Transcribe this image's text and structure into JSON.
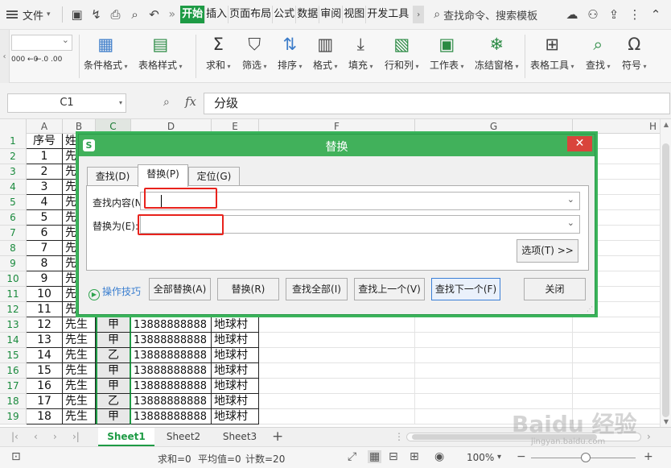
{
  "menubar": {
    "file": "文件",
    "tabs": [
      "开始",
      "插入",
      "页面布局",
      "公式",
      "数据",
      "审阅",
      "视图",
      "开发工具"
    ],
    "active_tab": "开始",
    "search_placeholder": "查找命令、搜索模板"
  },
  "ribbon": {
    "number_formats": [
      "000 ←0",
      "←.0 .00"
    ],
    "items": [
      {
        "label": "条件格式",
        "icon": "conditional-format-icon"
      },
      {
        "label": "表格样式",
        "icon": "table-style-icon"
      },
      {
        "label": "求和",
        "icon": "sum-icon"
      },
      {
        "label": "筛选",
        "icon": "filter-icon"
      },
      {
        "label": "排序",
        "icon": "sort-icon"
      },
      {
        "label": "格式",
        "icon": "format-icon"
      },
      {
        "label": "填充",
        "icon": "fill-icon"
      },
      {
        "label": "行和列",
        "icon": "row-col-icon"
      },
      {
        "label": "工作表",
        "icon": "worksheet-icon"
      },
      {
        "label": "冻结窗格",
        "icon": "freeze-icon"
      },
      {
        "label": "表格工具",
        "icon": "table-tool-icon"
      },
      {
        "label": "查找",
        "icon": "find-icon"
      },
      {
        "label": "符号",
        "icon": "symbol-icon"
      }
    ]
  },
  "formula_bar": {
    "name_box": "C1",
    "fx": "fx",
    "content": "分级"
  },
  "grid": {
    "columns": [
      "A",
      "B",
      "C",
      "D",
      "E",
      "F",
      "G",
      "H"
    ],
    "selected_column": "C",
    "rows": [
      {
        "n": "1",
        "a": "序号",
        "b": "姓",
        "c": "",
        "d": "",
        "e": ""
      },
      {
        "n": "2",
        "a": "1",
        "b": "先",
        "c": "",
        "d": "",
        "e": ""
      },
      {
        "n": "3",
        "a": "2",
        "b": "先",
        "c": "",
        "d": "",
        "e": ""
      },
      {
        "n": "4",
        "a": "3",
        "b": "先",
        "c": "",
        "d": "",
        "e": ""
      },
      {
        "n": "5",
        "a": "4",
        "b": "先",
        "c": "",
        "d": "",
        "e": ""
      },
      {
        "n": "6",
        "a": "5",
        "b": "先",
        "c": "",
        "d": "",
        "e": ""
      },
      {
        "n": "7",
        "a": "6",
        "b": "先",
        "c": "",
        "d": "",
        "e": ""
      },
      {
        "n": "8",
        "a": "7",
        "b": "先",
        "c": "",
        "d": "",
        "e": ""
      },
      {
        "n": "9",
        "a": "8",
        "b": "先",
        "c": "",
        "d": "",
        "e": ""
      },
      {
        "n": "10",
        "a": "9",
        "b": "先",
        "c": "",
        "d": "",
        "e": ""
      },
      {
        "n": "11",
        "a": "10",
        "b": "先",
        "c": "",
        "d": "",
        "e": ""
      },
      {
        "n": "12",
        "a": "11",
        "b": "先",
        "c": "",
        "d": "",
        "e": ""
      },
      {
        "n": "13",
        "a": "12",
        "b": "先生",
        "c": "甲",
        "d": "13888888888",
        "e": "地球村"
      },
      {
        "n": "14",
        "a": "13",
        "b": "先生",
        "c": "甲",
        "d": "13888888888",
        "e": "地球村"
      },
      {
        "n": "15",
        "a": "14",
        "b": "先生",
        "c": "乙",
        "d": "13888888888",
        "e": "地球村"
      },
      {
        "n": "16",
        "a": "15",
        "b": "先生",
        "c": "甲",
        "d": "13888888888",
        "e": "地球村"
      },
      {
        "n": "17",
        "a": "16",
        "b": "先生",
        "c": "甲",
        "d": "13888888888",
        "e": "地球村"
      },
      {
        "n": "18",
        "a": "17",
        "b": "先生",
        "c": "乙",
        "d": "13888888888",
        "e": "地球村"
      },
      {
        "n": "19",
        "a": "18",
        "b": "先生",
        "c": "甲",
        "d": "13888888888",
        "e": "地球村"
      }
    ]
  },
  "sheets": {
    "tabs": [
      "Sheet1",
      "Sheet2",
      "Sheet3"
    ],
    "active": "Sheet1",
    "add": "+"
  },
  "status": {
    "sum": "求和=0",
    "avg": "平均值=0",
    "count": "计数=20",
    "zoom": "100%"
  },
  "dialog": {
    "title": "替换",
    "logo": "S",
    "close": "✕",
    "tabs": [
      "查找(D)",
      "替换(P)",
      "定位(G)"
    ],
    "active_tab": "替换(P)",
    "find_label": "查找内容(N):",
    "find_value": "",
    "replace_label": "替换为(E):",
    "replace_value": "",
    "options_button": "选项(T) >>",
    "tips": "操作技巧",
    "buttons": {
      "replace_all": "全部替换(A)",
      "replace": "替换(R)",
      "find_all": "查找全部(I)",
      "find_prev": "查找上一个(V)",
      "find_next": "查找下一个(F)",
      "close": "关闭"
    }
  },
  "watermark": {
    "logo": "Baidu 经验",
    "url": "jingyan.baidu.com"
  },
  "colors": {
    "accent_green": "#1e9b45",
    "dialog_title": "#41b15b",
    "close_red": "#d9443c",
    "highlight_red": "#e8221c"
  }
}
